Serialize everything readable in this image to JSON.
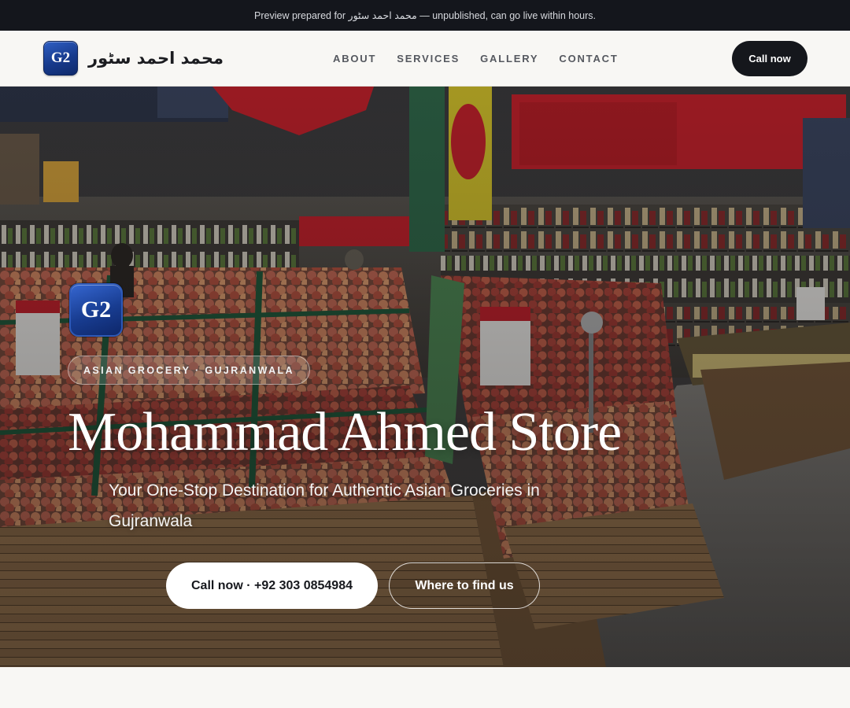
{
  "preview_banner": {
    "text": "Preview prepared for محمد احمد سٹور — unpublished, can go live within hours."
  },
  "header": {
    "logo_text": "G2",
    "brand_name": "محمد احمد سٹور",
    "nav": [
      {
        "label": "ABOUT"
      },
      {
        "label": "SERVICES"
      },
      {
        "label": "GALLERY"
      },
      {
        "label": "CONTACT"
      }
    ],
    "call_button": "Call now"
  },
  "hero": {
    "logo_text": "G2",
    "eyebrow": "ASIAN GROCERY · GUJRANWALA",
    "title": "Mohammad Ahmed Store",
    "subtitle": "Your One-Stop Destination for Authentic Asian Groceries in Gujranwala",
    "primary_button": "Call now · +92 303 0854984",
    "secondary_button": "Where to find us",
    "background_image": "grocery-store-produce-aisle"
  },
  "colors": {
    "banner_bg": "#14161c",
    "header_bg": "#f8f7f4",
    "nav_text": "#55585f",
    "dark_button": "#15171c",
    "logo_blue": "#183c90",
    "sign_red": "#c8202a"
  }
}
